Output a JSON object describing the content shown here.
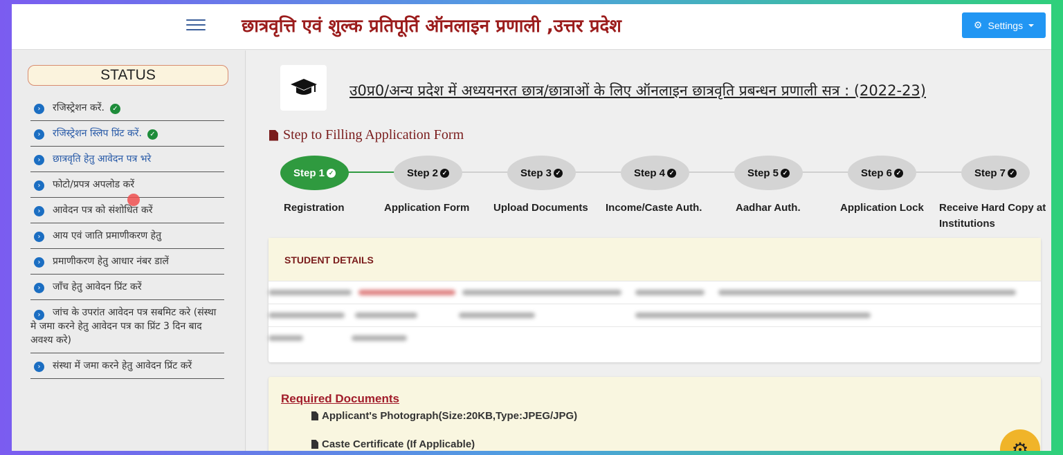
{
  "header": {
    "site_title": "छात्रवृत्ति एवं शुल्क प्रतिपूर्ति ऑनलाइन प्रणाली ,उत्तर प्रदेश",
    "settings_label": "Settings"
  },
  "sidebar": {
    "status_title": "STATUS",
    "items": [
      {
        "label": "रजिस्ट्रेशन करें."
      },
      {
        "label": "रजिस्ट्रेशन स्लिप प्रिंट करें."
      },
      {
        "label": "छात्रवृति हेतु आवेदन पत्र भरे"
      },
      {
        "label": "फोटो/प्रपत्र अपलोड करें"
      },
      {
        "label": "आवेदन पत्र को संशोधित करें"
      },
      {
        "label": "आय एवं जाति प्रमाणीकरण हेतु"
      },
      {
        "label": "प्रमाणीकरण हेतु आधार नंबर डालें"
      },
      {
        "label": "जाँच हेतु आवेदन प्रिंट करें"
      },
      {
        "label": "जांच के उपरांत आवेदन पत्र सबमिट करे (संस्था मे जमा करने हेतु आवेदन पत्र का प्रिंट 3 दिन बाद अवश्य करे)"
      },
      {
        "label": "संस्था में जमा करने हेतु आवेदन प्रिंट करें"
      }
    ]
  },
  "main": {
    "title": "उ0प्र0/अन्य प्रदेश में अध्ययनरत छात्र/छात्राओं के लिए ऑनलाइन छात्रवृति प्रबन्धन प्रणाली सत्र : (2022-23)",
    "steps_heading": "Step to Filling Application Form",
    "steps": [
      {
        "label": "Step 1",
        "caption": "Registration"
      },
      {
        "label": "Step 2",
        "caption": "Application Form"
      },
      {
        "label": "Step 3",
        "caption": "Upload Documents"
      },
      {
        "label": "Step 4",
        "caption": "Income/Caste Auth."
      },
      {
        "label": "Step 5",
        "caption": "Aadhar Auth."
      },
      {
        "label": "Step 6",
        "caption": "Application Lock"
      },
      {
        "label": "Step 7",
        "caption": "Receive Hard Copy at Institutions"
      }
    ],
    "student_details_title": "STUDENT DETAILS",
    "required_docs_title": "Required Documents",
    "docs": [
      "Applicant's Photograph(Size:20KB,Type:JPEG/JPG)",
      "Caste Certificate (If Applicable)"
    ]
  },
  "colors": {
    "title_red": "#9b1c1c",
    "active_step_green": "#2f9a3f",
    "settings_blue": "#2196f3"
  }
}
